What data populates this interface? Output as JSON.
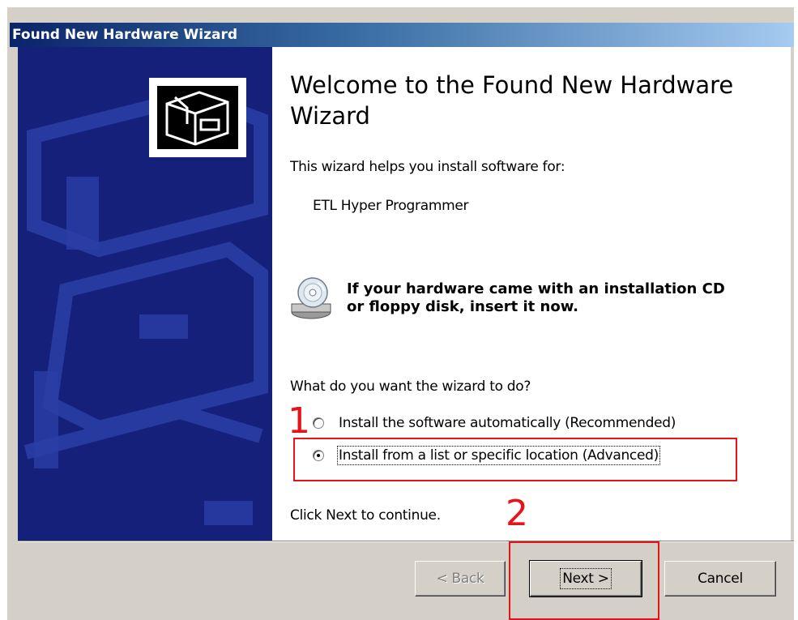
{
  "window": {
    "title": "Found New Hardware Wizard"
  },
  "content": {
    "heading": "Welcome to the Found New Hardware Wizard",
    "intro": "This wizard helps you install software for:",
    "device_name": "ETL Hyper Programmer",
    "cd_prompt_line1": "If your hardware came with an installation CD",
    "cd_prompt_line2": "or floppy disk, insert it now.",
    "question": "What do you want the wizard to do?",
    "options": [
      {
        "label": "Install the software automatically (Recommended)",
        "selected": false
      },
      {
        "label": "Install from a list or specific location (Advanced)",
        "selected": true
      }
    ],
    "footer_hint": "Click Next to continue."
  },
  "buttons": {
    "back": "< Back",
    "next": "Next >",
    "cancel": "Cancel"
  },
  "annotations": {
    "step1": "1",
    "step2": "2",
    "color": "#e8131a"
  },
  "icons": [
    "hardware-box-icon",
    "cd-drive-icon"
  ]
}
